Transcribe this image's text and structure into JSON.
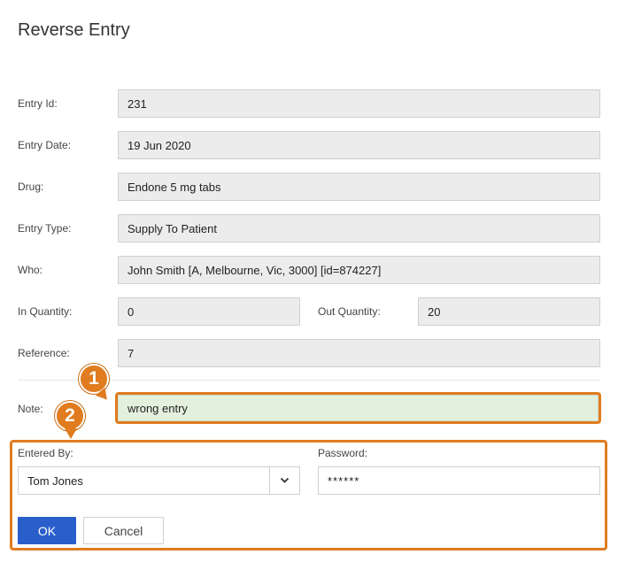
{
  "dialog": {
    "title": "Reverse Entry"
  },
  "fields": {
    "entry_id": {
      "label": "Entry Id:",
      "value": "231"
    },
    "entry_date": {
      "label": "Entry Date:",
      "value": "19 Jun 2020"
    },
    "drug": {
      "label": "Drug:",
      "value": "Endone 5 mg tabs"
    },
    "entry_type": {
      "label": "Entry Type:",
      "value": "Supply To Patient"
    },
    "who": {
      "label": "Who:",
      "value": "John Smith [A, Melbourne, Vic, 3000] [id=874227]"
    },
    "in_quantity": {
      "label": "In Quantity:",
      "value": "0"
    },
    "out_quantity": {
      "label": "Out Quantity:",
      "value": "20"
    },
    "reference": {
      "label": "Reference:",
      "value": "7"
    },
    "note": {
      "label": "Note:",
      "value": "wrong entry"
    }
  },
  "auth": {
    "entered_by_label": "Entered By:",
    "entered_by_value": "Tom Jones",
    "password_label": "Password:",
    "password_value": "******"
  },
  "buttons": {
    "ok": "OK",
    "cancel": "Cancel"
  },
  "callouts": {
    "one": "1",
    "two": "2"
  },
  "colors": {
    "highlight": "#e07c1f",
    "primary": "#2a5fcb",
    "note_bg": "#e3f0dd",
    "readonly_bg": "#ececec"
  },
  "icons": {
    "dropdown": "chevron-down-icon"
  }
}
